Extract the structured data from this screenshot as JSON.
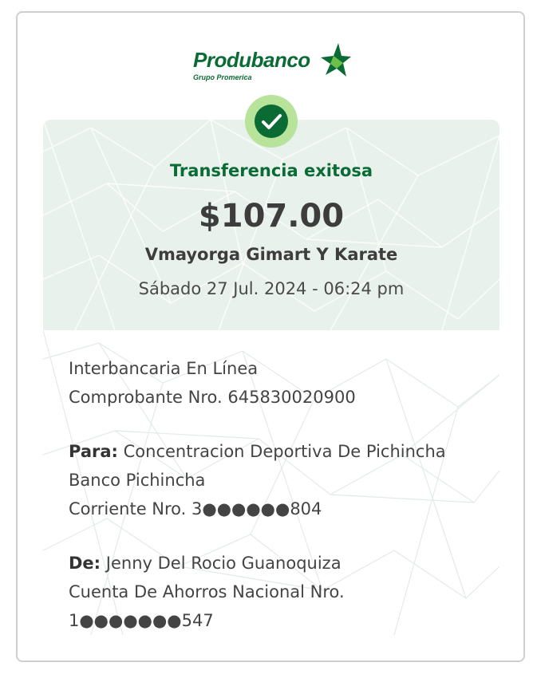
{
  "brand": {
    "name": "Produbanco",
    "subtitle": "Grupo Promerica",
    "green": "#0b6b35",
    "light_green": "#6cc04a"
  },
  "receipt": {
    "status": "Transferencia exitosa",
    "amount": "$107.00",
    "beneficiary_name": "Vmayorga Gimart Y Karate",
    "datetime": "Sábado 27 Jul. 2024 - 06:24 pm",
    "transfer_type": "Interbancaria En Línea",
    "voucher": "Comprobante Nro. 645830020900",
    "to_label": "Para:",
    "to_name": "Concentracion Deportiva De Pichincha",
    "to_bank": "Banco Pichincha",
    "to_account": "Corriente Nro. 3●●●●●●804",
    "from_label": "De:",
    "from_name": "Jenny Del Rocio Guanoquiza",
    "from_account_type": "Cuenta De Ahorros Nacional Nro.",
    "from_account_number": "1●●●●●●●547"
  },
  "icons": {
    "success": "check-circle-icon",
    "logo_star": "star-icon"
  }
}
